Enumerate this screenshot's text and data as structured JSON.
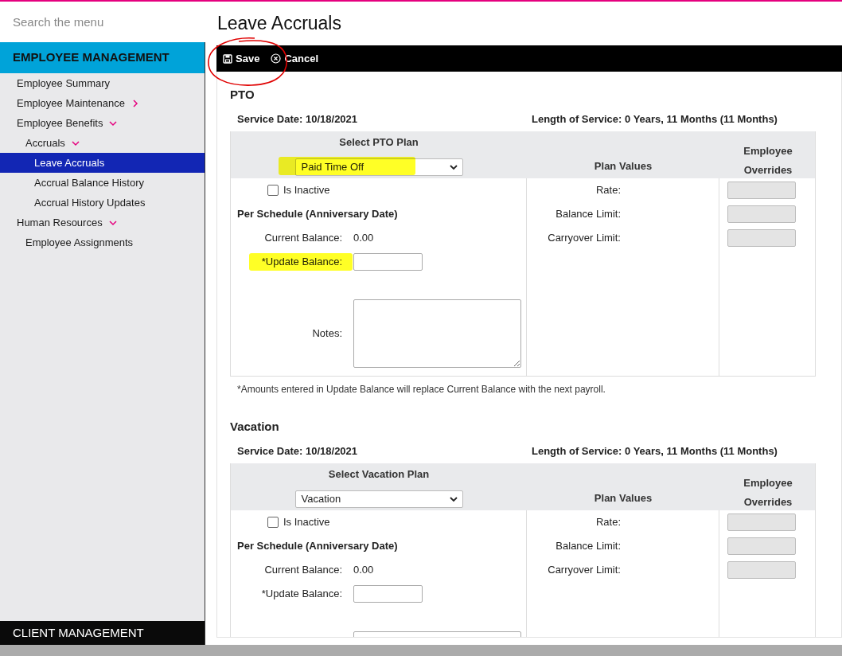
{
  "sidebar": {
    "search_placeholder": "Search the menu",
    "section_title": "EMPLOYEE MANAGEMENT",
    "items": [
      {
        "label": "Employee Summary",
        "selected": false
      },
      {
        "label": "Employee Maintenance",
        "selected": false,
        "expanded": false
      },
      {
        "label": "Employee Benefits",
        "selected": false,
        "expanded": true,
        "children": [
          {
            "label": "Accruals",
            "selected": false,
            "expanded": true,
            "children": [
              {
                "label": "Leave Accruals",
                "selected": true
              },
              {
                "label": "Accrual Balance History",
                "selected": false
              },
              {
                "label": "Accrual History Updates",
                "selected": false
              }
            ]
          }
        ]
      },
      {
        "label": "Human Resources",
        "selected": false,
        "expanded": true,
        "children": [
          {
            "label": "Employee Assignments",
            "selected": false
          }
        ]
      }
    ],
    "bottom_section_title": "CLIENT MANAGEMENT"
  },
  "page_title": "Leave Accruals",
  "toolbar": [
    {
      "label": "Save",
      "kind": "save"
    },
    {
      "label": "Cancel",
      "kind": "cancel"
    }
  ],
  "sections": [
    {
      "title": "PTO",
      "service_date": "Service Date: 10/18/2021",
      "length_of_service": "Length of Service: 0 Years, 11 Months (11 Months)",
      "select_label": "Select PTO Plan",
      "plan": "Paid Time Off",
      "plan_highlighted": true,
      "plan_values_heading": "Plan Values",
      "overrides_heading": "Employee Overrides",
      "inactive": {
        "label": "Is Inactive",
        "checked": false
      },
      "schedule_heading": "Per Schedule (Anniversary Date)",
      "current_balance_label": "Current Balance:",
      "current_balance": "0.00",
      "update_balance_label": "*Update Balance:",
      "update_highlighted": true,
      "notes_label": "Notes:",
      "plan_values": [
        {
          "label": "Rate:",
          "disabled": true
        },
        {
          "label": "Balance Limit:",
          "disabled": true
        },
        {
          "label": "Carryover Limit:",
          "disabled": true
        }
      ],
      "footnote": "*Amounts entered in Update Balance will replace Current Balance with the next payroll."
    },
    {
      "title": "Vacation",
      "service_date": "Service Date: 10/18/2021",
      "length_of_service": "Length of Service: 0 Years, 11 Months (11 Months)",
      "select_label": "Select Vacation Plan",
      "plan": "Vacation",
      "plan_highlighted": false,
      "plan_values_heading": "Plan Values",
      "overrides_heading": "Employee Overrides",
      "inactive": {
        "label": "Is Inactive",
        "checked": false
      },
      "schedule_heading": "Per Schedule (Anniversary Date)",
      "current_balance_label": "Current Balance:",
      "current_balance": "0.00",
      "update_balance_label": "*Update Balance:",
      "update_highlighted": false,
      "plan_values": [
        {
          "label": "Rate:",
          "disabled": true
        },
        {
          "label": "Balance Limit:",
          "disabled": true
        },
        {
          "label": "Carryover Limit:",
          "disabled": true
        }
      ]
    }
  ]
}
